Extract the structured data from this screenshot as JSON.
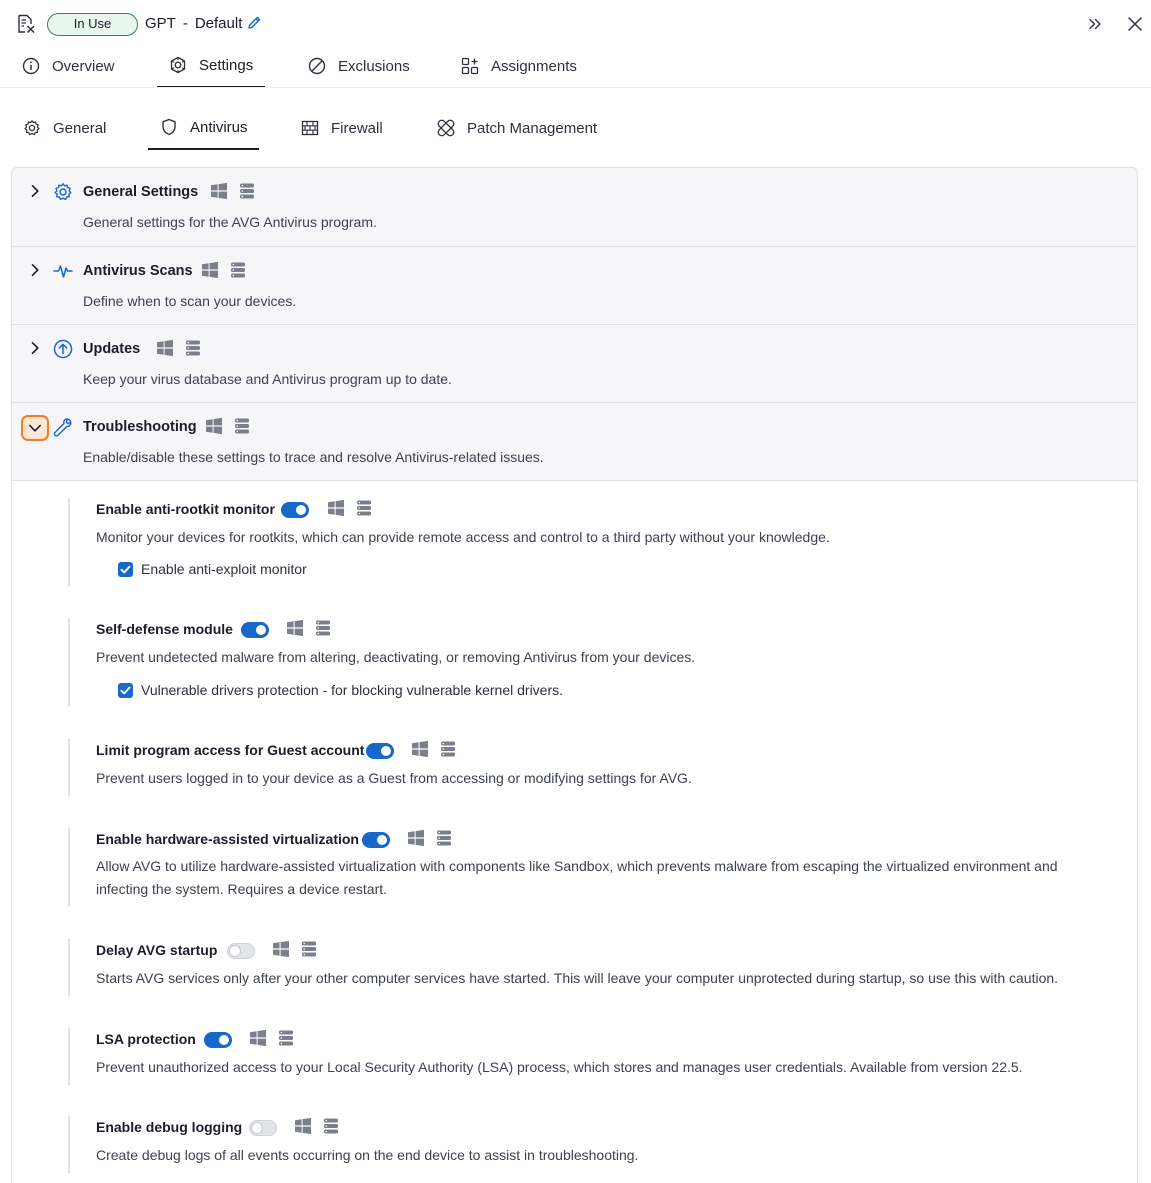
{
  "header": {
    "status": "In Use",
    "policy_name": "GPT",
    "separator": "-",
    "policy_variant": "Default"
  },
  "main_tabs": [
    {
      "label": "Overview",
      "icon": "info-icon"
    },
    {
      "label": "Settings",
      "icon": "settings-gear-icon",
      "active": true
    },
    {
      "label": "Exclusions",
      "icon": "no-entry-icon"
    },
    {
      "label": "Assignments",
      "icon": "grid-plus-icon"
    }
  ],
  "sub_tabs": [
    {
      "label": "General",
      "icon": "gear-icon"
    },
    {
      "label": "Antivirus",
      "icon": "shield-icon",
      "active": true
    },
    {
      "label": "Firewall",
      "icon": "brick-wall-icon"
    },
    {
      "label": "Patch Management",
      "icon": "bandage-icon"
    }
  ],
  "sections": [
    {
      "title": "General Settings",
      "description": "General settings for the AVG Antivirus program.",
      "icon": "gear-icon",
      "expanded": false
    },
    {
      "title": "Antivirus Scans",
      "description": "Define when to scan your devices.",
      "icon": "pulse-icon",
      "expanded": false
    },
    {
      "title": "Updates",
      "description": "Keep your virus database and Antivirus program up to date.",
      "icon": "arrow-up-circle-icon",
      "expanded": false
    },
    {
      "title": "Troubleshooting",
      "description": "Enable/disable these settings to trace and resolve Antivirus-related issues.",
      "icon": "wrench-icon",
      "expanded": true
    }
  ],
  "settings": [
    {
      "title": "Enable anti-rootkit monitor",
      "enabled": true,
      "description": "Monitor your devices for rootkits, which can provide remote access and control to a third party without your knowledge.",
      "checkbox": "Enable anti-exploit monitor"
    },
    {
      "title": "Self-defense module",
      "enabled": true,
      "description": "Prevent undetected malware from altering, deactivating, or removing Antivirus from your devices.",
      "checkbox": "Vulnerable drivers protection - for blocking vulnerable kernel drivers."
    },
    {
      "title": "Limit program access for Guest account",
      "enabled": true,
      "description": "Prevent users logged in to your device as a Guest from accessing or modifying settings for AVG."
    },
    {
      "title": "Enable hardware-assisted virtualization",
      "enabled": true,
      "description": "Allow AVG to utilize hardware-assisted virtualization with components like Sandbox, which prevents malware from escaping the virtualized environment and infecting the system. Requires a device restart."
    },
    {
      "title": "Delay AVG startup",
      "enabled": false,
      "description": "Starts AVG services only after your other computer services have started. This will leave your computer unprotected during startup, so use this with caution."
    },
    {
      "title": "LSA protection",
      "enabled": true,
      "description": "Prevent unauthorized access to your Local Security Authority (LSA) process, which stores and manages user credentials. Available from version 22.5."
    },
    {
      "title": "Enable debug logging",
      "enabled": false,
      "description": "Create debug logs of all events occurring on the end device to assist in troubleshooting."
    }
  ],
  "colors": {
    "accent": "#1668c9",
    "status_border": "#2e8b57",
    "focus_orange": "#f47b20",
    "section_bg": "#f6f6f8"
  }
}
